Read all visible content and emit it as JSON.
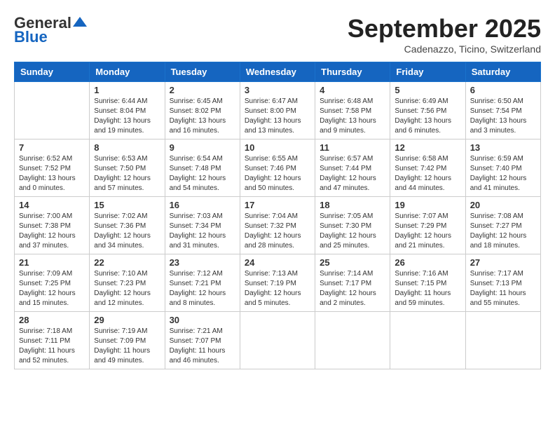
{
  "header": {
    "logo_general": "General",
    "logo_blue": "Blue",
    "month_title": "September 2025",
    "location": "Cadenazzo, Ticino, Switzerland"
  },
  "weekdays": [
    "Sunday",
    "Monday",
    "Tuesday",
    "Wednesday",
    "Thursday",
    "Friday",
    "Saturday"
  ],
  "weeks": [
    [
      {
        "day": "",
        "sunrise": "",
        "sunset": "",
        "daylight": ""
      },
      {
        "day": "1",
        "sunrise": "Sunrise: 6:44 AM",
        "sunset": "Sunset: 8:04 PM",
        "daylight": "Daylight: 13 hours and 19 minutes."
      },
      {
        "day": "2",
        "sunrise": "Sunrise: 6:45 AM",
        "sunset": "Sunset: 8:02 PM",
        "daylight": "Daylight: 13 hours and 16 minutes."
      },
      {
        "day": "3",
        "sunrise": "Sunrise: 6:47 AM",
        "sunset": "Sunset: 8:00 PM",
        "daylight": "Daylight: 13 hours and 13 minutes."
      },
      {
        "day": "4",
        "sunrise": "Sunrise: 6:48 AM",
        "sunset": "Sunset: 7:58 PM",
        "daylight": "Daylight: 13 hours and 9 minutes."
      },
      {
        "day": "5",
        "sunrise": "Sunrise: 6:49 AM",
        "sunset": "Sunset: 7:56 PM",
        "daylight": "Daylight: 13 hours and 6 minutes."
      },
      {
        "day": "6",
        "sunrise": "Sunrise: 6:50 AM",
        "sunset": "Sunset: 7:54 PM",
        "daylight": "Daylight: 13 hours and 3 minutes."
      }
    ],
    [
      {
        "day": "7",
        "sunrise": "Sunrise: 6:52 AM",
        "sunset": "Sunset: 7:52 PM",
        "daylight": "Daylight: 13 hours and 0 minutes."
      },
      {
        "day": "8",
        "sunrise": "Sunrise: 6:53 AM",
        "sunset": "Sunset: 7:50 PM",
        "daylight": "Daylight: 12 hours and 57 minutes."
      },
      {
        "day": "9",
        "sunrise": "Sunrise: 6:54 AM",
        "sunset": "Sunset: 7:48 PM",
        "daylight": "Daylight: 12 hours and 54 minutes."
      },
      {
        "day": "10",
        "sunrise": "Sunrise: 6:55 AM",
        "sunset": "Sunset: 7:46 PM",
        "daylight": "Daylight: 12 hours and 50 minutes."
      },
      {
        "day": "11",
        "sunrise": "Sunrise: 6:57 AM",
        "sunset": "Sunset: 7:44 PM",
        "daylight": "Daylight: 12 hours and 47 minutes."
      },
      {
        "day": "12",
        "sunrise": "Sunrise: 6:58 AM",
        "sunset": "Sunset: 7:42 PM",
        "daylight": "Daylight: 12 hours and 44 minutes."
      },
      {
        "day": "13",
        "sunrise": "Sunrise: 6:59 AM",
        "sunset": "Sunset: 7:40 PM",
        "daylight": "Daylight: 12 hours and 41 minutes."
      }
    ],
    [
      {
        "day": "14",
        "sunrise": "Sunrise: 7:00 AM",
        "sunset": "Sunset: 7:38 PM",
        "daylight": "Daylight: 12 hours and 37 minutes."
      },
      {
        "day": "15",
        "sunrise": "Sunrise: 7:02 AM",
        "sunset": "Sunset: 7:36 PM",
        "daylight": "Daylight: 12 hours and 34 minutes."
      },
      {
        "day": "16",
        "sunrise": "Sunrise: 7:03 AM",
        "sunset": "Sunset: 7:34 PM",
        "daylight": "Daylight: 12 hours and 31 minutes."
      },
      {
        "day": "17",
        "sunrise": "Sunrise: 7:04 AM",
        "sunset": "Sunset: 7:32 PM",
        "daylight": "Daylight: 12 hours and 28 minutes."
      },
      {
        "day": "18",
        "sunrise": "Sunrise: 7:05 AM",
        "sunset": "Sunset: 7:30 PM",
        "daylight": "Daylight: 12 hours and 25 minutes."
      },
      {
        "day": "19",
        "sunrise": "Sunrise: 7:07 AM",
        "sunset": "Sunset: 7:29 PM",
        "daylight": "Daylight: 12 hours and 21 minutes."
      },
      {
        "day": "20",
        "sunrise": "Sunrise: 7:08 AM",
        "sunset": "Sunset: 7:27 PM",
        "daylight": "Daylight: 12 hours and 18 minutes."
      }
    ],
    [
      {
        "day": "21",
        "sunrise": "Sunrise: 7:09 AM",
        "sunset": "Sunset: 7:25 PM",
        "daylight": "Daylight: 12 hours and 15 minutes."
      },
      {
        "day": "22",
        "sunrise": "Sunrise: 7:10 AM",
        "sunset": "Sunset: 7:23 PM",
        "daylight": "Daylight: 12 hours and 12 minutes."
      },
      {
        "day": "23",
        "sunrise": "Sunrise: 7:12 AM",
        "sunset": "Sunset: 7:21 PM",
        "daylight": "Daylight: 12 hours and 8 minutes."
      },
      {
        "day": "24",
        "sunrise": "Sunrise: 7:13 AM",
        "sunset": "Sunset: 7:19 PM",
        "daylight": "Daylight: 12 hours and 5 minutes."
      },
      {
        "day": "25",
        "sunrise": "Sunrise: 7:14 AM",
        "sunset": "Sunset: 7:17 PM",
        "daylight": "Daylight: 12 hours and 2 minutes."
      },
      {
        "day": "26",
        "sunrise": "Sunrise: 7:16 AM",
        "sunset": "Sunset: 7:15 PM",
        "daylight": "Daylight: 11 hours and 59 minutes."
      },
      {
        "day": "27",
        "sunrise": "Sunrise: 7:17 AM",
        "sunset": "Sunset: 7:13 PM",
        "daylight": "Daylight: 11 hours and 55 minutes."
      }
    ],
    [
      {
        "day": "28",
        "sunrise": "Sunrise: 7:18 AM",
        "sunset": "Sunset: 7:11 PM",
        "daylight": "Daylight: 11 hours and 52 minutes."
      },
      {
        "day": "29",
        "sunrise": "Sunrise: 7:19 AM",
        "sunset": "Sunset: 7:09 PM",
        "daylight": "Daylight: 11 hours and 49 minutes."
      },
      {
        "day": "30",
        "sunrise": "Sunrise: 7:21 AM",
        "sunset": "Sunset: 7:07 PM",
        "daylight": "Daylight: 11 hours and 46 minutes."
      },
      {
        "day": "",
        "sunrise": "",
        "sunset": "",
        "daylight": ""
      },
      {
        "day": "",
        "sunrise": "",
        "sunset": "",
        "daylight": ""
      },
      {
        "day": "",
        "sunrise": "",
        "sunset": "",
        "daylight": ""
      },
      {
        "day": "",
        "sunrise": "",
        "sunset": "",
        "daylight": ""
      }
    ]
  ]
}
